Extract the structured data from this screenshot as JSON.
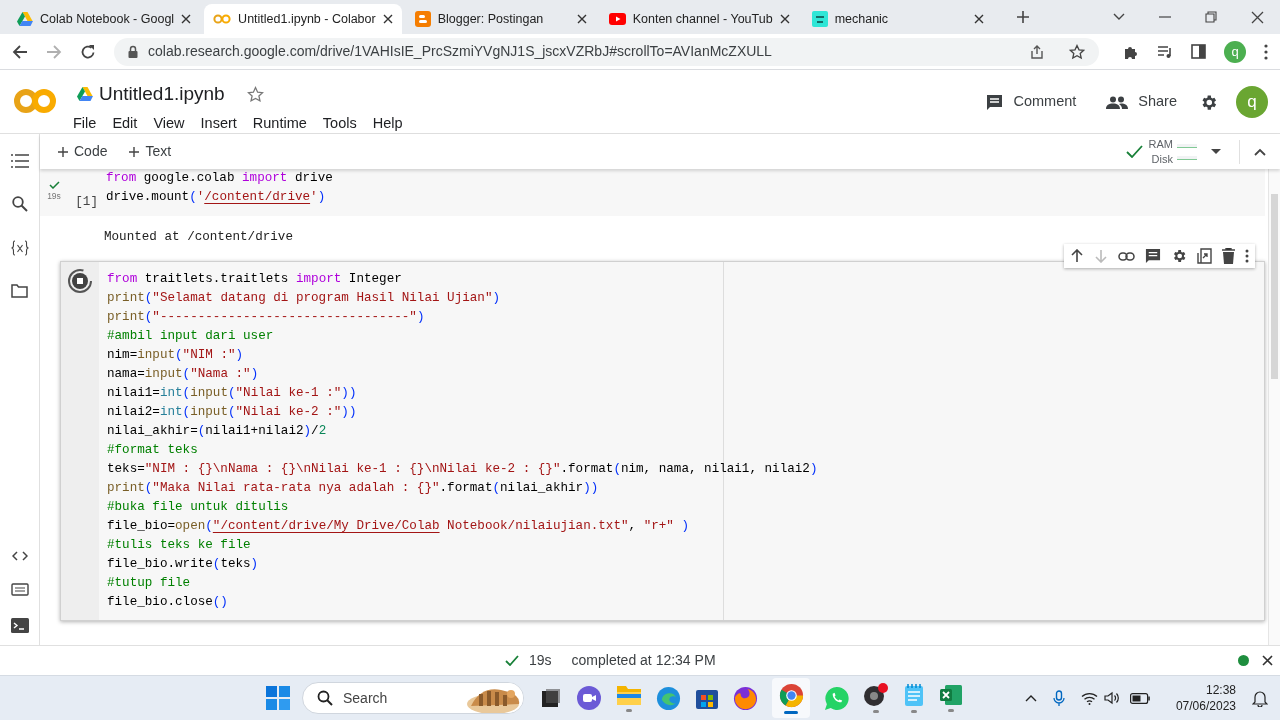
{
  "browser": {
    "tabs": [
      {
        "kind": "drive",
        "title": "Colab Notebook - Googl",
        "selected": false
      },
      {
        "kind": "colab",
        "title": "Untitled1.ipynb - Colabor",
        "selected": true
      },
      {
        "kind": "blogger",
        "title": "Blogger: Postingan",
        "selected": false
      },
      {
        "kind": "video",
        "title": "Konten channel - YouTub",
        "selected": false
      },
      {
        "kind": "site",
        "title": "mechanic",
        "selected": false
      }
    ],
    "url": "colab.research.google.com/drive/1VAHIsIE_PrcSzmiYVgNJ1S_jscxVZRbJ#scrollTo=AVIanMcZXULL",
    "profile": "q"
  },
  "notebook": {
    "title": "Untitled1.ipynb",
    "starred": false,
    "menu": [
      "File",
      "Edit",
      "View",
      "Insert",
      "Runtime",
      "Tools",
      "Help"
    ],
    "comment": "Comment",
    "share": "Share",
    "avatar": "q"
  },
  "toolbar": {
    "add_buttons": [
      "Code",
      "Text"
    ],
    "ram": "RAM",
    "disk": "Disk"
  },
  "cells": [
    {
      "kind": "done",
      "focused": false,
      "duration": "19s",
      "count": "[1]",
      "output": "Mounted at /content/drive",
      "lines": [
        [
          {
            "kind": "keyword",
            "text": "from"
          },
          {
            "kind": "plain",
            "text": " google.colab "
          },
          {
            "kind": "keyword",
            "text": "import"
          },
          {
            "kind": "plain",
            "text": " drive"
          }
        ],
        [
          {
            "kind": "plain",
            "text": "drive.mount"
          },
          {
            "kind": "bracket",
            "text": "("
          },
          {
            "kind": "string",
            "text": "'"
          },
          {
            "kind": "link",
            "text": "/content/drive"
          },
          {
            "kind": "string",
            "text": "'"
          },
          {
            "kind": "bracket",
            "text": ")"
          }
        ]
      ]
    },
    {
      "kind": "running",
      "focused": true,
      "lines": [
        [
          {
            "kind": "keyword",
            "text": "from"
          },
          {
            "kind": "plain",
            "text": " traitlets.traitlets "
          },
          {
            "kind": "keyword",
            "text": "import"
          },
          {
            "kind": "plain",
            "text": " Integer"
          }
        ],
        [
          {
            "kind": "function",
            "text": "print"
          },
          {
            "kind": "bracket",
            "text": "("
          },
          {
            "kind": "string",
            "text": "\"Selamat datang di program Hasil Nilai Ujian\""
          },
          {
            "kind": "bracket",
            "text": ")"
          }
        ],
        [
          {
            "kind": "function",
            "text": "print"
          },
          {
            "kind": "bracket",
            "text": "("
          },
          {
            "kind": "string",
            "text": "\"---------------------------------\""
          },
          {
            "kind": "bracket",
            "text": ")"
          }
        ],
        [
          {
            "kind": "comment",
            "text": "#ambil input dari user"
          }
        ],
        [
          {
            "kind": "plain",
            "text": "nim="
          },
          {
            "kind": "function",
            "text": "input"
          },
          {
            "kind": "bracket",
            "text": "("
          },
          {
            "kind": "string",
            "text": "\"NIM :\""
          },
          {
            "kind": "bracket",
            "text": ")"
          }
        ],
        [
          {
            "kind": "plain",
            "text": "nama="
          },
          {
            "kind": "function",
            "text": "input"
          },
          {
            "kind": "bracket",
            "text": "("
          },
          {
            "kind": "string",
            "text": "\"Nama :\""
          },
          {
            "kind": "bracket",
            "text": ")"
          }
        ],
        [
          {
            "kind": "plain",
            "text": "nilai1="
          },
          {
            "kind": "type",
            "text": "int"
          },
          {
            "kind": "bracket",
            "text": "("
          },
          {
            "kind": "function",
            "text": "input"
          },
          {
            "kind": "bracket",
            "text": "("
          },
          {
            "kind": "string",
            "text": "\"Nilai ke-1 :\""
          },
          {
            "kind": "bracket",
            "text": "))"
          }
        ],
        [
          {
            "kind": "plain",
            "text": "nilai2="
          },
          {
            "kind": "type",
            "text": "int"
          },
          {
            "kind": "bracket",
            "text": "("
          },
          {
            "kind": "function",
            "text": "input"
          },
          {
            "kind": "bracket",
            "text": "("
          },
          {
            "kind": "string",
            "text": "\"Nilai ke-2 :\""
          },
          {
            "kind": "bracket",
            "text": "))"
          }
        ],
        [
          {
            "kind": "plain",
            "text": "nilai_akhir="
          },
          {
            "kind": "bracket",
            "text": "("
          },
          {
            "kind": "plain",
            "text": "nilai1+nilai2"
          },
          {
            "kind": "bracket",
            "text": ")"
          },
          {
            "kind": "plain",
            "text": "/"
          },
          {
            "kind": "number",
            "text": "2"
          }
        ],
        [
          {
            "kind": "comment",
            "text": "#format teks"
          }
        ],
        [
          {
            "kind": "plain",
            "text": "teks="
          },
          {
            "kind": "string",
            "text": "\"NIM : {}\\nNama : {}\\nNilai ke-1 : {}\\nNilai ke-2 : {}\""
          },
          {
            "kind": "plain",
            "text": ".format"
          },
          {
            "kind": "bracket",
            "text": "("
          },
          {
            "kind": "plain",
            "text": "nim, nama, nilai1, nilai2"
          },
          {
            "kind": "bracket",
            "text": ")"
          }
        ],
        [
          {
            "kind": "function",
            "text": "print"
          },
          {
            "kind": "bracket",
            "text": "("
          },
          {
            "kind": "string",
            "text": "\"Maka Nilai rata-rata nya adalah : {}\""
          },
          {
            "kind": "plain",
            "text": ".format"
          },
          {
            "kind": "bracket",
            "text": "("
          },
          {
            "kind": "plain",
            "text": "nilai_akhir"
          },
          {
            "kind": "bracket",
            "text": "))"
          }
        ],
        [
          {
            "kind": "comment",
            "text": "#buka file untuk ditulis"
          }
        ],
        [
          {
            "kind": "plain",
            "text": "file_bio="
          },
          {
            "kind": "function",
            "text": "open"
          },
          {
            "kind": "bracket",
            "text": "("
          },
          {
            "kind": "link",
            "text": "\"/content/drive/My Drive/Colab"
          },
          {
            "kind": "string",
            "text": " Notebook/nilaiujian.txt\""
          },
          {
            "kind": "plain",
            "text": ", "
          },
          {
            "kind": "string",
            "text": "\"r+\""
          },
          {
            "kind": "bracket",
            "text": " )"
          }
        ],
        [
          {
            "kind": "comment",
            "text": "#tulis teks ke file"
          }
        ],
        [
          {
            "kind": "plain",
            "text": "file_bio.write"
          },
          {
            "kind": "bracket",
            "text": "("
          },
          {
            "kind": "plain",
            "text": "teks"
          },
          {
            "kind": "bracket",
            "text": ")"
          }
        ],
        [
          {
            "kind": "comment",
            "text": "#tutup file"
          }
        ],
        [
          {
            "kind": "plain",
            "text": "file_bio.close"
          },
          {
            "kind": "bracket",
            "text": "()"
          }
        ]
      ]
    }
  ],
  "status_bar": {
    "duration": "19s",
    "message": "completed at 12:34 PM"
  },
  "taskbar": {
    "search": "Search",
    "time": "12:38",
    "date": "07/06/2023"
  }
}
